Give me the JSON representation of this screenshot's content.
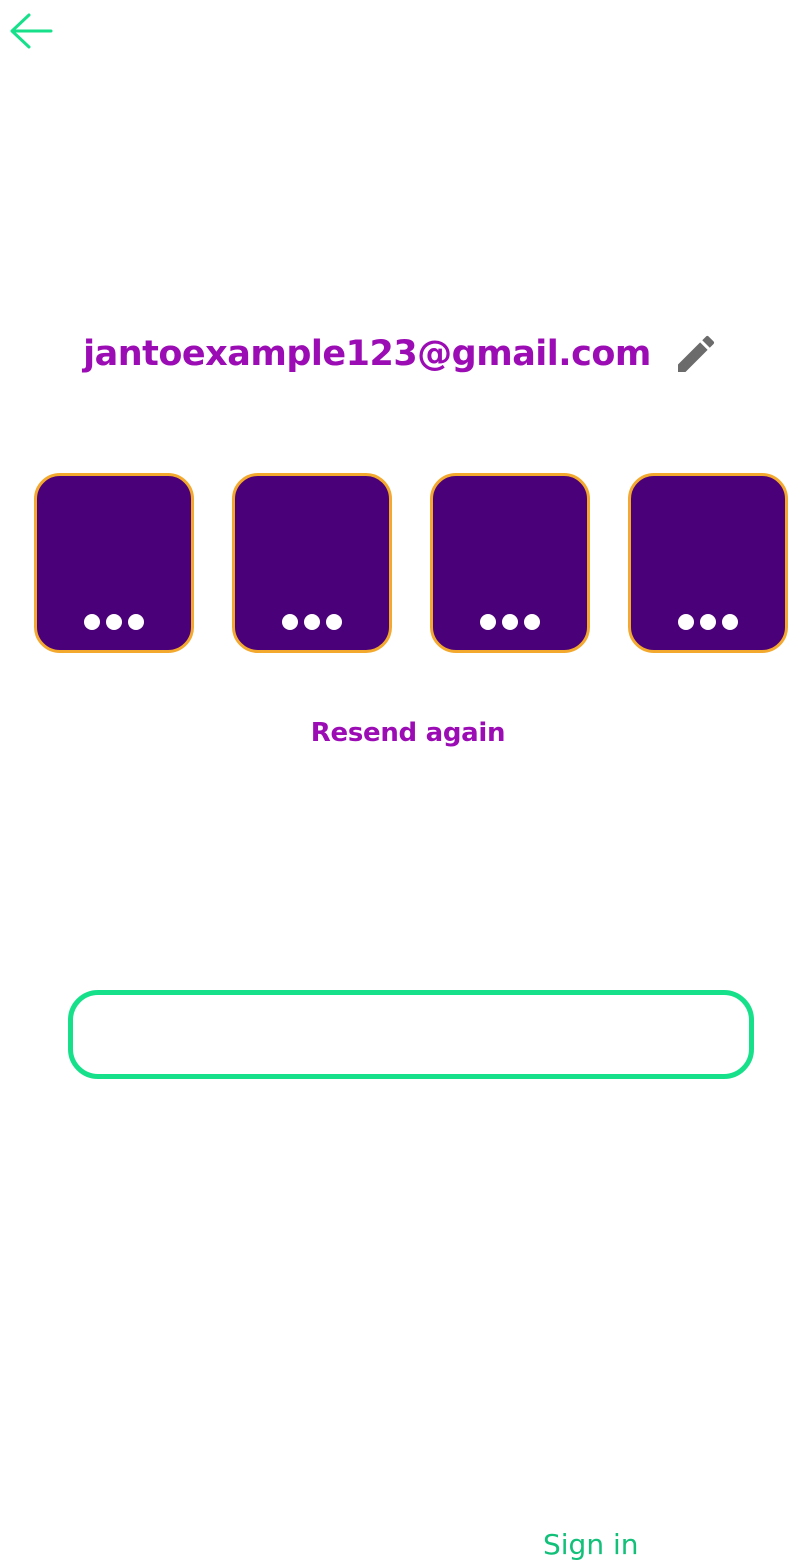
{
  "header": {
    "back_icon": "arrow-left-icon"
  },
  "account": {
    "email": "jantoexample123@gmail.com",
    "edit_icon": "pencil-icon"
  },
  "code_inputs": [
    {
      "mask": "●●●"
    },
    {
      "mask": "●●●"
    },
    {
      "mask": "●●●"
    },
    {
      "mask": "●●●"
    }
  ],
  "actions": {
    "resend_label": "Resend again",
    "signin_label": "Sign in"
  },
  "colors": {
    "accent_green": "#16e08a",
    "brand_purple": "#9b0cb5",
    "box_fill": "#4a0078",
    "box_border": "#f3a82e",
    "icon_gray": "#6b6b6b"
  }
}
